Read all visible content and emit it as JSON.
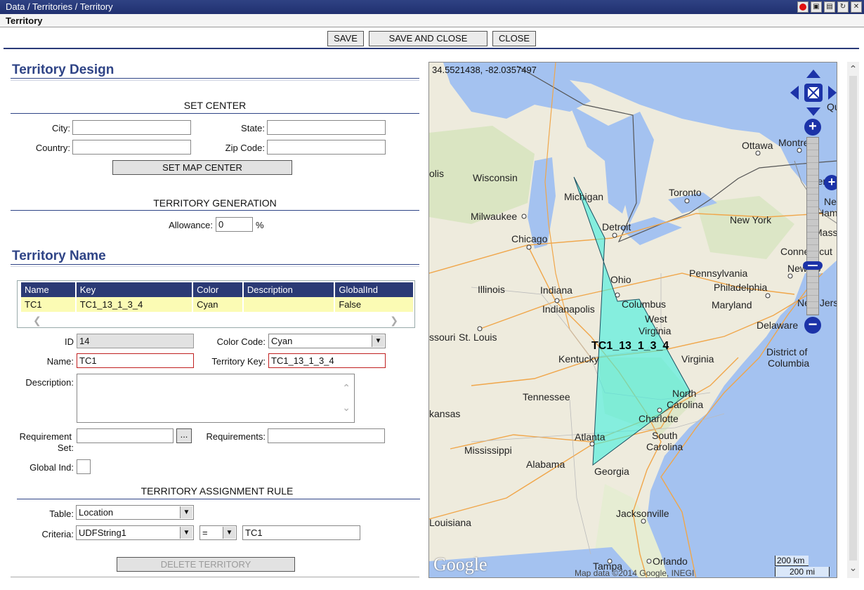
{
  "window": {
    "breadcrumb": "Data / Territories / Territory",
    "subtitle": "Territory"
  },
  "toolbar": {
    "save_label": "SAVE",
    "save_close_label": "SAVE AND CLOSE",
    "close_label": "CLOSE"
  },
  "design": {
    "heading": "Territory Design",
    "set_center": "SET CENTER",
    "city_label": "City:",
    "city_value": "",
    "state_label": "State:",
    "state_value": "",
    "country_label": "Country:",
    "country_value": "",
    "zip_label": "Zip Code:",
    "zip_value": "",
    "set_map_center_label": "SET MAP CENTER",
    "generation": "TERRITORY GENERATION",
    "allowance_label": "Allowance:",
    "allowance_value": "0",
    "allowance_unit": "%"
  },
  "names": {
    "heading": "Territory Name",
    "columns": [
      "Name",
      "Key",
      "Color",
      "Description",
      "GlobalInd"
    ],
    "rows": [
      {
        "name": "TC1",
        "key": "TC1_13_1_3_4",
        "color": "Cyan",
        "description": "",
        "global": "False"
      }
    ]
  },
  "details": {
    "id_label": "ID",
    "id_value": "14",
    "color_code_label": "Color Code:",
    "color_code_value": "Cyan",
    "name_label": "Name:",
    "name_value": "TC1",
    "territory_key_label": "Territory Key:",
    "territory_key_value": "TC1_13_1_3_4",
    "description_label": "Description:",
    "description_value": "",
    "req_set_label_1": "Requirement",
    "req_set_label_2": "Set:",
    "req_set_value": "",
    "ellipsis_label": "...",
    "requirements_label": "Requirements:",
    "requirements_value": "",
    "global_ind_label": "Global Ind:"
  },
  "rule": {
    "heading": "TERRITORY ASSIGNMENT RULE",
    "table_label": "Table:",
    "table_value": "Location",
    "criteria_label": "Criteria:",
    "criteria_field": "UDFString1",
    "criteria_operator": "=",
    "criteria_value": "TC1",
    "delete_label": "DELETE TERRITORY"
  },
  "map": {
    "coords": "34.5521438, -82.0357497",
    "territory_label": "TC1_13_1_3_4",
    "territory_color": "#40f0e0",
    "attribution": "Map data ©2014 Google, INEGI",
    "google_logo": "Google",
    "scale_km": "200 km",
    "scale_mi": "200 mi",
    "labels": [
      {
        "text": "Wisconsin"
      },
      {
        "text": "Michigan"
      },
      {
        "text": "Milwaukee"
      },
      {
        "text": "Chicago"
      },
      {
        "text": "Detroit"
      },
      {
        "text": "Toronto"
      },
      {
        "text": "Ottawa"
      },
      {
        "text": "Montreal"
      },
      {
        "text": "New York"
      },
      {
        "text": "Pennsylvania"
      },
      {
        "text": "Philadelphia"
      },
      {
        "text": "Connecticut"
      },
      {
        "text": "Illinois"
      },
      {
        "text": "Indiana"
      },
      {
        "text": "Ohio"
      },
      {
        "text": "Columbus"
      },
      {
        "text": "Indianapolis"
      },
      {
        "text": "Maryland"
      },
      {
        "text": "Delaware"
      },
      {
        "text": "District of"
      },
      {
        "text": "Columbia"
      },
      {
        "text": "West"
      },
      {
        "text": "Virginia"
      },
      {
        "text": "St. Louis"
      },
      {
        "text": "ssouri"
      },
      {
        "text": "Kentucky"
      },
      {
        "text": "Virginia"
      },
      {
        "text": "Tennessee"
      },
      {
        "text": "North"
      },
      {
        "text": "Carolina"
      },
      {
        "text": "Charlotte"
      },
      {
        "text": "kansas"
      },
      {
        "text": "Atlanta"
      },
      {
        "text": "South"
      },
      {
        "text": "Carolina"
      },
      {
        "text": "Mississippi"
      },
      {
        "text": "Alabama"
      },
      {
        "text": "Georgia"
      },
      {
        "text": "Louisiana"
      },
      {
        "text": "Jacksonville"
      },
      {
        "text": "Tampa"
      },
      {
        "text": "Orlando"
      },
      {
        "text": "olis"
      },
      {
        "text": "Vermo"
      },
      {
        "text": "Ne"
      },
      {
        "text": "Hamp"
      },
      {
        "text": "Massac"
      },
      {
        "text": "New Yo"
      },
      {
        "text": "New Jers"
      },
      {
        "text": "Qu"
      }
    ]
  },
  "colors": {
    "title_bar": "#203070",
    "heading": "#2f4486",
    "grid_header": "#2b3a75",
    "grid_row": "#fbfbb4",
    "water": "#a4c2f0",
    "land": "#f0ece0"
  }
}
